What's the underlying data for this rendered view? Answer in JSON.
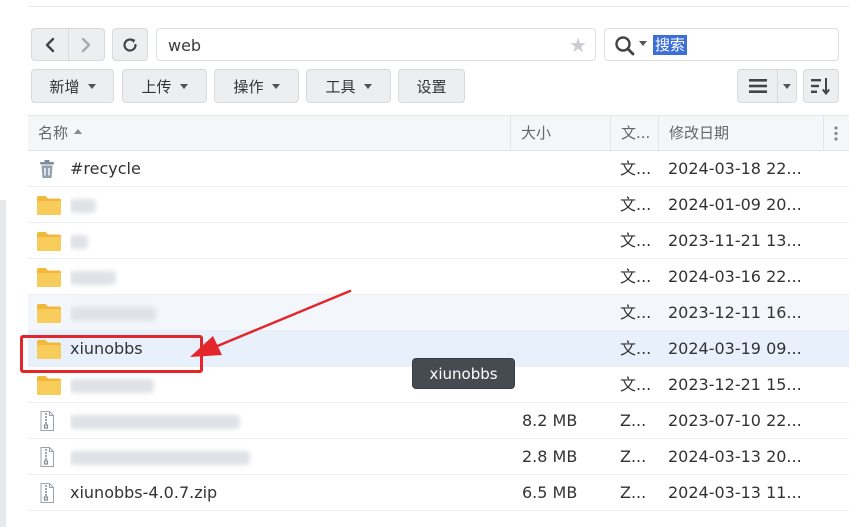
{
  "nav": {
    "path": "web",
    "search_placeholder": "搜索"
  },
  "toolbar": {
    "new_label": "新增",
    "upload_label": "上传",
    "action_label": "操作",
    "tools_label": "工具",
    "settings_label": "设置"
  },
  "table": {
    "columns": {
      "name": "名称",
      "size": "大小",
      "type": "文...",
      "modified": "修改日期"
    },
    "rows": [
      {
        "icon": "trash-icon",
        "name": "#recycle",
        "size": "",
        "type": "文...",
        "modified": "2024-03-18 22..."
      },
      {
        "icon": "folder-icon",
        "name": "",
        "size": "",
        "type": "文...",
        "modified": "2024-01-09 20..."
      },
      {
        "icon": "folder-icon",
        "name": "",
        "size": "",
        "type": "文...",
        "modified": "2023-11-21 13..."
      },
      {
        "icon": "folder-icon",
        "name": "",
        "size": "",
        "type": "文...",
        "modified": "2024-03-16 22..."
      },
      {
        "icon": "folder-icon",
        "name": "",
        "size": "",
        "type": "文...",
        "modified": "2023-12-11 16..."
      },
      {
        "icon": "folder-icon",
        "name": "xiunobbs",
        "size": "",
        "type": "文...",
        "modified": "2024-03-19 09..."
      },
      {
        "icon": "folder-icon",
        "name": "",
        "size": "",
        "type": "文...",
        "modified": "2023-12-21 15..."
      },
      {
        "icon": "zip-file-icon",
        "name": "",
        "size": "8.2 MB",
        "type": "Z...",
        "modified": "2023-07-10 22..."
      },
      {
        "icon": "zip-file-icon",
        "name": "",
        "size": "2.8 MB",
        "type": "Z...",
        "modified": "2024-03-13 20..."
      },
      {
        "icon": "zip-file-icon",
        "name": "xiunobbs-4.0.7.zip",
        "size": "6.5 MB",
        "type": "Z...",
        "modified": "2024-03-13 11..."
      }
    ]
  },
  "tooltip": {
    "text": "xiunobbs"
  },
  "colors": {
    "annotation_red": "#e3262b",
    "search_highlight": "#3c6fd6",
    "folder_yellow": "#f7c547",
    "selected_row": "#e7f0fb"
  }
}
